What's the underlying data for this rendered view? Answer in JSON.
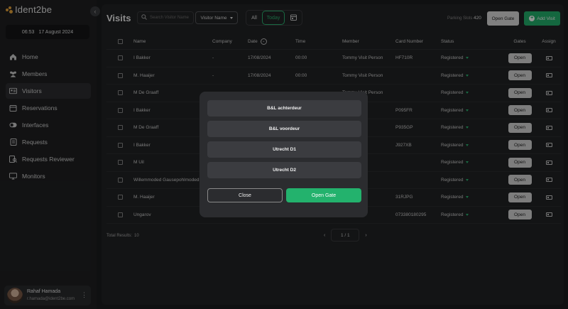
{
  "app": {
    "logo_text": "Ident2be"
  },
  "clock": {
    "time": "06:53",
    "date": "17 August 2024"
  },
  "sidebar": {
    "items": [
      {
        "label": "Home",
        "icon": "home-icon"
      },
      {
        "label": "Members",
        "icon": "members-icon"
      },
      {
        "label": "Visitors",
        "icon": "visitors-icon",
        "active": true
      },
      {
        "label": "Reservations",
        "icon": "calendar-icon"
      },
      {
        "label": "Interfaces",
        "icon": "toggle-icon"
      },
      {
        "label": "Requests",
        "icon": "requests-icon"
      },
      {
        "label": "Requests Reviewer",
        "icon": "reviewer-icon"
      },
      {
        "label": "Monitors",
        "icon": "monitor-icon"
      }
    ]
  },
  "user": {
    "name": "Rahaf Hamada",
    "email": "r.hamada@ident2be.com"
  },
  "header": {
    "title": "Visits",
    "search_placeholder": "Search Visitor Name",
    "filter_select": "Visitor Name",
    "tab_all": "All",
    "tab_today": "Today",
    "parking_label": "Parking Slots",
    "parking_value": "420",
    "open_gate_label": "Open Gate",
    "add_visit_label": "Add Visit"
  },
  "table": {
    "columns": [
      "Name",
      "Company",
      "Date",
      "Time",
      "Member",
      "Card Number",
      "Status",
      "Gates",
      "Assign"
    ],
    "rows": [
      {
        "name": "I Bakker",
        "company": "-",
        "date": "17/08/2024",
        "time": "00:00",
        "member": "Tommy Visit Person",
        "card": "HF710R",
        "status": "Registered",
        "gate": "Open"
      },
      {
        "name": "M. Haaijer",
        "company": "-",
        "date": "17/08/2024",
        "time": "00:00",
        "member": "Tommy Visit Person",
        "card": "",
        "status": "Registered",
        "gate": "Open"
      },
      {
        "name": "M De Graaff",
        "company": "",
        "date": "",
        "time": "",
        "member": "Tommy Visit Person",
        "card": "",
        "status": "Registered",
        "gate": "Open"
      },
      {
        "name": "I Bakker",
        "company": "",
        "date": "",
        "time": "",
        "member": "erson",
        "card": "P095FR",
        "status": "Registered",
        "gate": "Open"
      },
      {
        "name": "M De Graaff",
        "company": "",
        "date": "",
        "time": "",
        "member": "erson",
        "card": "P935GP",
        "status": "Registered",
        "gate": "Open"
      },
      {
        "name": "I Bakker",
        "company": "",
        "date": "",
        "time": "",
        "member": "erson",
        "card": "J927XB",
        "status": "Registered",
        "gate": "Open"
      },
      {
        "name": "M Uil",
        "company": "",
        "date": "",
        "time": "",
        "member": "erson",
        "card": "",
        "status": "Registered",
        "gate": "Open"
      },
      {
        "name": "Willemmoded Gausepohlmoded",
        "company": "",
        "date": "",
        "time": "",
        "member": "erson",
        "card": "",
        "status": "Registered",
        "gate": "Open"
      },
      {
        "name": "M. Haaijer",
        "company": "",
        "date": "",
        "time": "",
        "member": "erson",
        "card": "31RJPG",
        "status": "Registered",
        "gate": "Open"
      },
      {
        "name": "Ungarov",
        "company": "",
        "date": "",
        "time": "",
        "member": "son",
        "card": "073380180295",
        "status": "Registered",
        "gate": "Open"
      }
    ]
  },
  "footer": {
    "total_label": "Total Results:",
    "total_value": "10",
    "page": "1",
    "pages": "1"
  },
  "modal": {
    "gates": [
      "B&L achterdeur",
      "B&L voordeur",
      "Utrecht D1",
      "Utrecht D2"
    ],
    "close_label": "Close",
    "open_label": "Open Gate"
  },
  "colors": {
    "accent_green": "#23b26d",
    "logo_orange": "#e8a53b"
  }
}
